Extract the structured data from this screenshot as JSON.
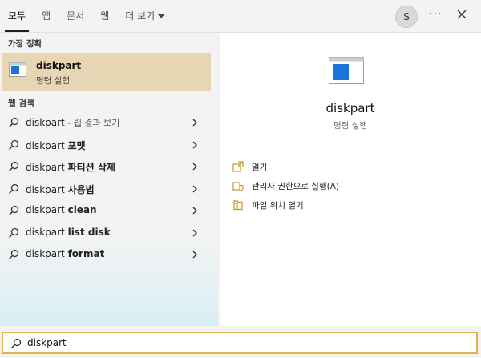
{
  "tabs": [
    {
      "label": "모두"
    },
    {
      "label": "앱"
    },
    {
      "label": "문서"
    },
    {
      "label": "웹"
    },
    {
      "label": "더 보기"
    }
  ],
  "user": {
    "initial": "S"
  },
  "more_label": "···",
  "best_match": {
    "section_title": "가장 정확",
    "name": "diskpart",
    "type": "명령 실행"
  },
  "web_search": {
    "section_title": "웹 검색",
    "items": [
      {
        "query": "diskpart",
        "suffix": "",
        "note": " - 웹 결과 보기"
      },
      {
        "query": "diskpart ",
        "suffix": "포맷",
        "note": ""
      },
      {
        "query": "diskpart ",
        "suffix": "파티션 삭제",
        "note": ""
      },
      {
        "query": "diskpart ",
        "suffix": "사용법",
        "note": ""
      },
      {
        "query": "diskpart ",
        "suffix": "clean",
        "note": ""
      },
      {
        "query": "diskpart ",
        "suffix": "list disk",
        "note": ""
      },
      {
        "query": "diskpart ",
        "suffix": "format",
        "note": ""
      }
    ]
  },
  "preview": {
    "name": "diskpart",
    "type": "명령 실행",
    "actions": [
      {
        "label": "열기",
        "icon": "open-icon"
      },
      {
        "label": "관리자 권한으로 실행(A)",
        "icon": "shield-icon"
      },
      {
        "label": "파일 위치 열기",
        "icon": "folder-icon"
      }
    ]
  },
  "search": {
    "value": "diskpart"
  },
  "colors": {
    "highlight": "#e7d6b3",
    "search_border": "#e0b64a",
    "app_blue": "#1a73d9"
  }
}
